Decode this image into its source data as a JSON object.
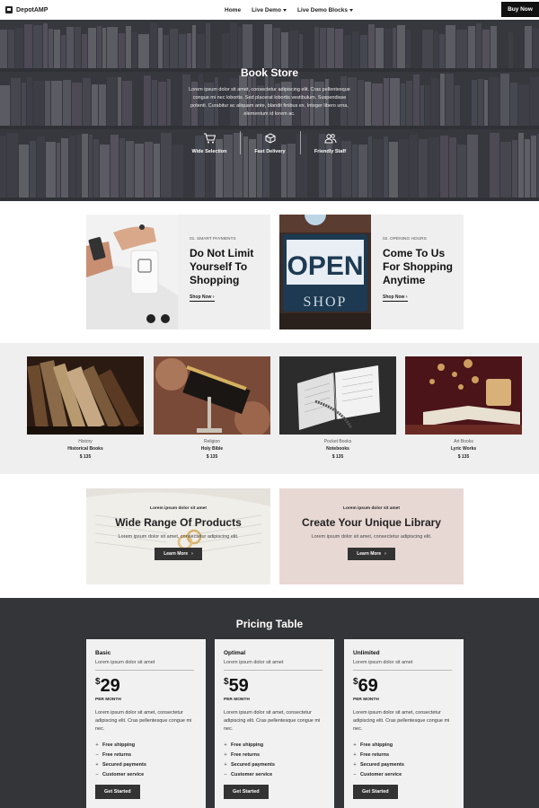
{
  "header": {
    "logo": "DepotAMP",
    "nav": [
      {
        "label": "Home"
      },
      {
        "label": "Live Demo"
      },
      {
        "label": "Live Demo Blocks"
      }
    ],
    "cta": "Buy Now"
  },
  "hero": {
    "title": "Book Store",
    "text": "Lorem ipsum dolor sit amet, consectetur adipiscing elit. Cras pellentesque congue mi nec lobortis. Sed placerat lobortis vestibulum. Suspendisse potenti. Curabitur ac aliquam ante, blandit finibus ex. Integer libero urna, elementum id lorem ac.",
    "features": [
      {
        "icon": "cart-icon",
        "label": "Wide Selection"
      },
      {
        "icon": "box-icon",
        "label": "Fast Delivery"
      },
      {
        "icon": "users-icon",
        "label": "Friendly Staff"
      }
    ]
  },
  "promos": [
    {
      "eyebrow": "01. SMART PAYMENTS",
      "title": "Do Not Limit Yourself To Shopping",
      "link": "Shop Now"
    },
    {
      "eyebrow": "02. OPENING HOURS",
      "title": "Come To Us For Shopping Anytime",
      "link": "Shop Now",
      "sign_top": "OPEN",
      "sign_bottom": "SHOP"
    }
  ],
  "categories": [
    {
      "genre": "History",
      "name": "Historical Books",
      "price": "$ 135"
    },
    {
      "genre": "Religion",
      "name": "Holy Bible",
      "price": "$ 135"
    },
    {
      "genre": "Pocket Books",
      "name": "Notebooks",
      "price": "$ 135"
    },
    {
      "genre": "Art Books",
      "name": "Lyric Works",
      "price": "$ 135"
    }
  ],
  "banners": [
    {
      "eyebrow": "Lorem ipsum dolor sit amet",
      "title": "Wide Range Of Products",
      "text": "Lorem ipsum dolor sit amet, consectetur adipiscing elit.",
      "button": "Learn More"
    },
    {
      "eyebrow": "Lorem ipsum dolor sit amet",
      "title": "Create Your Unique Library",
      "text": "Lorem ipsum dolor sit amet, consectetur adipiscing elit.",
      "button": "Learn More"
    }
  ],
  "pricing": {
    "title": "Pricing Table",
    "plans": [
      {
        "name": "Basic",
        "subtitle": "Lorem ipsum dolor sit amet",
        "currency": "$",
        "amount": "29",
        "period": "PER MONTH",
        "description": "Lorem ipsum dolor sit amet, consectetur adipiscing elit. Cras pellentesque congue mi nec.",
        "features": [
          {
            "mark": "+",
            "label": "Free shipping"
          },
          {
            "mark": "–",
            "label": "Free returns"
          },
          {
            "mark": "+",
            "label": "Secured payments"
          },
          {
            "mark": "–",
            "label": "Customer service"
          }
        ],
        "button": "Get Started"
      },
      {
        "name": "Optimal",
        "subtitle": "Lorem ipsum dolor sit amet",
        "currency": "$",
        "amount": "59",
        "period": "PER MONTH",
        "description": "Lorem ipsum dolor sit amet, consectetur adipiscing elit. Cras pellentesque congue mi nec.",
        "features": [
          {
            "mark": "+",
            "label": "Free shipping"
          },
          {
            "mark": "+",
            "label": "Free returns"
          },
          {
            "mark": "+",
            "label": "Secured payments"
          },
          {
            "mark": "–",
            "label": "Customer service"
          }
        ],
        "button": "Get Started"
      },
      {
        "name": "Unlimited",
        "subtitle": "Lorem ipsum dolor sit amet",
        "currency": "$",
        "amount": "69",
        "period": "PER MONTH",
        "description": "Lorem ipsum dolor sit amet, consectetur adipiscing elit. Cras pellentesque congue mi nec.",
        "features": [
          {
            "mark": "+",
            "label": "Free shipping"
          },
          {
            "mark": "+",
            "label": "Free returns"
          },
          {
            "mark": "+",
            "label": "Secured payments"
          },
          {
            "mark": "–",
            "label": "Customer service"
          }
        ],
        "button": "Get Started"
      }
    ]
  },
  "colors": {
    "dark": "#343538",
    "light_panel": "#efefef",
    "accent_pink": "#e8d8d4",
    "button": "#333333"
  }
}
